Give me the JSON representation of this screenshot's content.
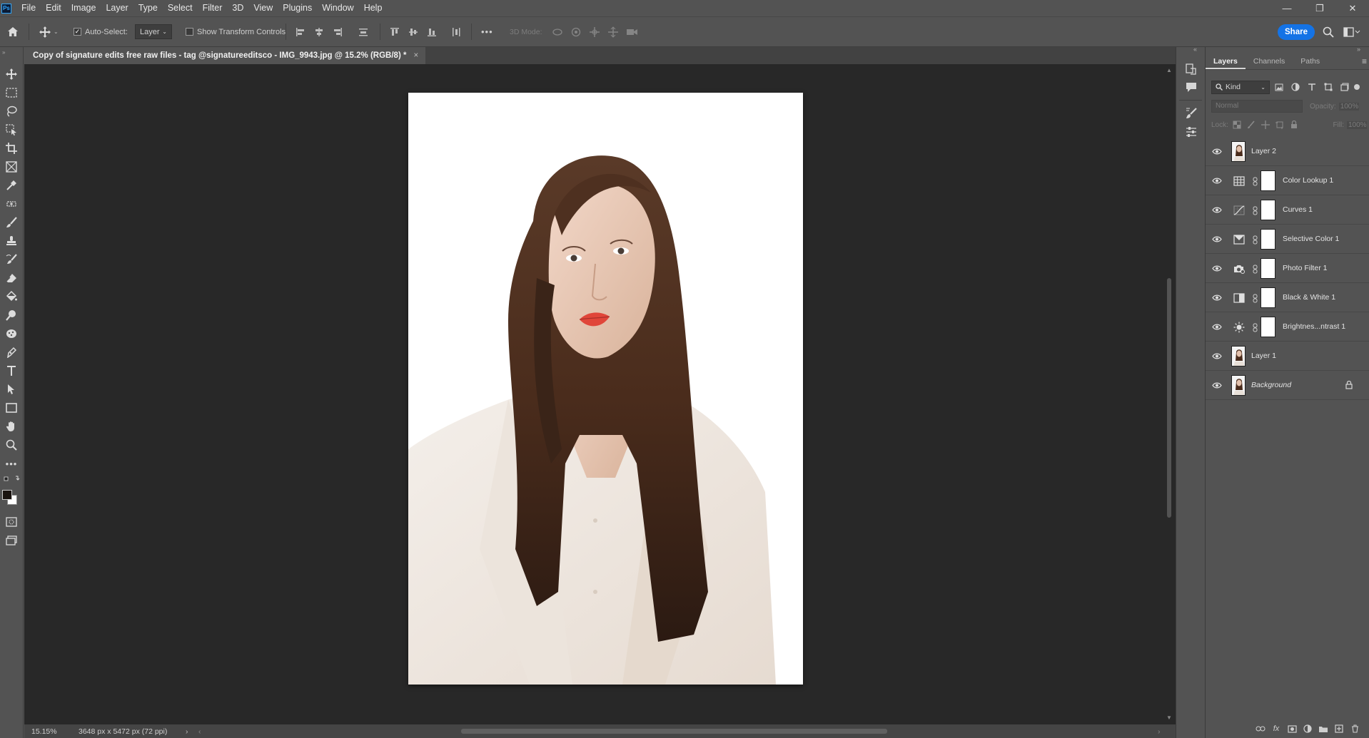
{
  "menu": [
    "File",
    "Edit",
    "Image",
    "Layer",
    "Type",
    "Select",
    "Filter",
    "3D",
    "View",
    "Plugins",
    "Window",
    "Help"
  ],
  "options": {
    "auto_select_label": "Auto-Select:",
    "auto_select_value": "Layer",
    "show_transform_label": "Show Transform Controls",
    "mode_3d_label": "3D Mode:",
    "share_label": "Share",
    "more_label": "•••"
  },
  "document": {
    "tab_title": "Copy of signature edits free raw files - tag @signatureeditsco - IMG_9943.jpg @ 15.2% (RGB/8) *",
    "close": "×"
  },
  "status": {
    "zoom": "15.15%",
    "dimensions": "3648 px x 5472 px (72 ppi)"
  },
  "panel": {
    "tabs": [
      "Layers",
      "Channels",
      "Paths"
    ],
    "filter_kind": "Kind",
    "blend_mode": "Normal",
    "opacity_label": "Opacity:",
    "opacity_value": "100%",
    "lock_label": "Lock:",
    "fill_label": "Fill:",
    "fill_value": "100%"
  },
  "layers": [
    {
      "name": "Layer 2",
      "type": "pixel",
      "visible": true
    },
    {
      "name": "Color Lookup 1",
      "type": "adjustment",
      "icon": "grid-icon",
      "visible": true
    },
    {
      "name": "Curves 1",
      "type": "adjustment",
      "icon": "curves-icon",
      "visible": true
    },
    {
      "name": "Selective Color 1",
      "type": "adjustment",
      "icon": "selective-color-icon",
      "visible": true
    },
    {
      "name": "Photo Filter 1",
      "type": "adjustment",
      "icon": "photo-filter-icon",
      "visible": true
    },
    {
      "name": "Black & White 1",
      "type": "adjustment",
      "icon": "black-white-icon",
      "visible": true
    },
    {
      "name": "Brightnes...ntrast 1",
      "type": "adjustment",
      "icon": "brightness-icon",
      "visible": true
    },
    {
      "name": "Layer 1",
      "type": "pixel",
      "visible": true
    },
    {
      "name": "Background",
      "type": "pixel",
      "visible": true,
      "locked": true
    }
  ],
  "colors": {
    "accent": "#1473e6",
    "app_bg": "#535353",
    "canvas_bg": "#282828"
  }
}
